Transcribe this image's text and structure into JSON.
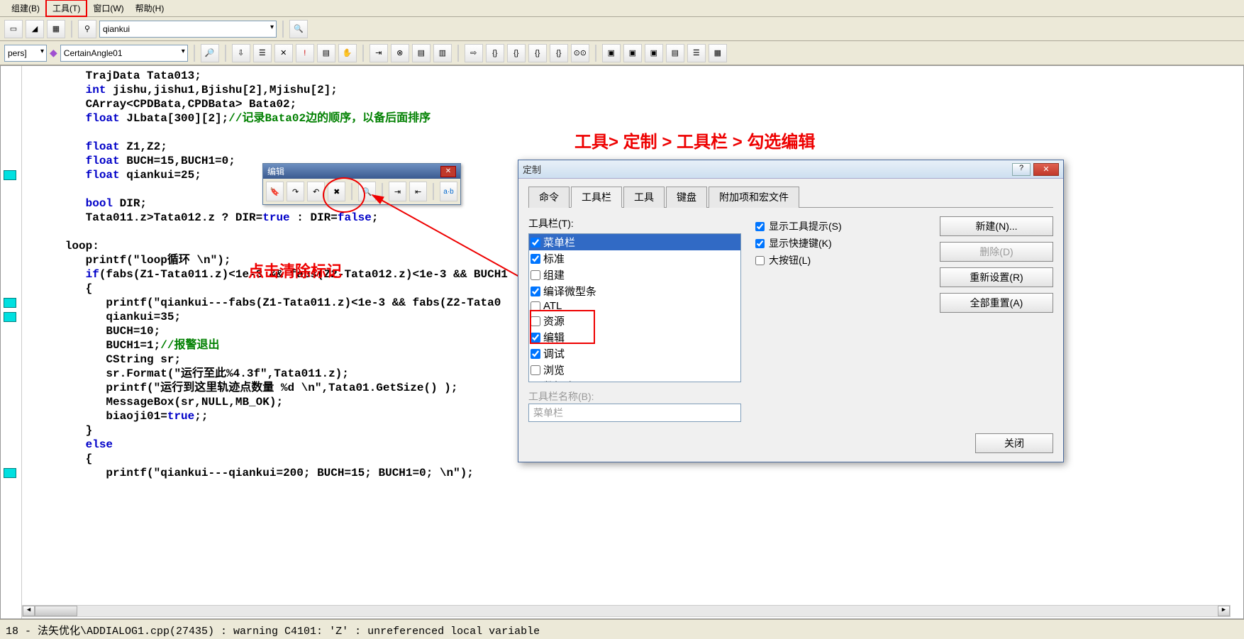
{
  "menu": {
    "build": "组建(B)",
    "tools": "工具(T)",
    "window": "窗口(W)",
    "help": "帮助(H)"
  },
  "toolbar2": {
    "search_value": "qiankui"
  },
  "toolbar3": {
    "left_label": "pers]",
    "combo_value": "CertainAngle01"
  },
  "float_tb": {
    "title": "编辑"
  },
  "anno": {
    "path_hint": "工具> 定制 > 工具栏 > 勾选编辑",
    "click_hint": "点击清除标记"
  },
  "code": [
    {
      "indent": 6,
      "segs": [
        {
          "t": "TrajData Tata013;",
          "c": ""
        }
      ]
    },
    {
      "indent": 6,
      "segs": [
        {
          "t": "int",
          "c": "kw"
        },
        {
          "t": " jishu,jishu1,Bjishu[2],Mjishu[2];",
          "c": ""
        }
      ]
    },
    {
      "indent": 6,
      "segs": [
        {
          "t": "CArray<CPDBata,CPDBata> Bata02;",
          "c": ""
        }
      ]
    },
    {
      "indent": 6,
      "segs": [
        {
          "t": "float",
          "c": "kw"
        },
        {
          "t": " JLbata[300][2];",
          "c": ""
        },
        {
          "t": "//记录Bata02边的顺序，以备后面排序",
          "c": "cm"
        }
      ]
    },
    {
      "indent": 6,
      "segs": [
        {
          "t": "",
          "c": ""
        }
      ]
    },
    {
      "indent": 6,
      "segs": [
        {
          "t": "float",
          "c": "kw"
        },
        {
          "t": " Z1,Z2;",
          "c": ""
        }
      ]
    },
    {
      "indent": 6,
      "segs": [
        {
          "t": "float",
          "c": "kw"
        },
        {
          "t": " BUCH=15,BUCH1=0;",
          "c": ""
        }
      ]
    },
    {
      "indent": 6,
      "bm": true,
      "segs": [
        {
          "t": "float",
          "c": "kw"
        },
        {
          "t": " qiankui=25;",
          "c": ""
        }
      ]
    },
    {
      "indent": 6,
      "segs": [
        {
          "t": "",
          "c": ""
        }
      ]
    },
    {
      "indent": 6,
      "segs": [
        {
          "t": "bool",
          "c": "kw"
        },
        {
          "t": " DIR;",
          "c": ""
        }
      ]
    },
    {
      "indent": 6,
      "segs": [
        {
          "t": "Tata011.z>Tata012.z ? DIR=",
          "c": ""
        },
        {
          "t": "true",
          "c": "tf"
        },
        {
          "t": " : DIR=",
          "c": ""
        },
        {
          "t": "false",
          "c": "tf"
        },
        {
          "t": ";",
          "c": ""
        }
      ]
    },
    {
      "indent": 6,
      "segs": [
        {
          "t": "",
          "c": ""
        }
      ]
    },
    {
      "indent": 3,
      "segs": [
        {
          "t": "loop:",
          "c": ""
        }
      ]
    },
    {
      "indent": 6,
      "segs": [
        {
          "t": "printf(\"loop循环 \\n\");",
          "c": ""
        }
      ]
    },
    {
      "indent": 6,
      "segs": [
        {
          "t": "if",
          "c": "kw"
        },
        {
          "t": "(fabs(Z1-Tata011.z)<1e-3 && fabs(Z2-Tata012.z)<1e-3 && BUCH1",
          "c": ""
        }
      ]
    },
    {
      "indent": 6,
      "segs": [
        {
          "t": "{",
          "c": ""
        }
      ]
    },
    {
      "indent": 9,
      "bm": true,
      "segs": [
        {
          "t": "printf(\"qiankui---fabs(Z1-Tata011.z)<1e-3 && fabs(Z2-Tata0",
          "c": ""
        }
      ]
    },
    {
      "indent": 9,
      "bm": true,
      "segs": [
        {
          "t": "qiankui=35;",
          "c": ""
        }
      ]
    },
    {
      "indent": 9,
      "segs": [
        {
          "t": "BUCH=10;",
          "c": ""
        }
      ]
    },
    {
      "indent": 9,
      "segs": [
        {
          "t": "BUCH1=1;",
          "c": ""
        },
        {
          "t": "//报警退出",
          "c": "cm"
        }
      ]
    },
    {
      "indent": 9,
      "segs": [
        {
          "t": "CString sr;",
          "c": ""
        }
      ]
    },
    {
      "indent": 9,
      "segs": [
        {
          "t": "sr.Format(\"运行至此%4.3f\",Tata011.z);",
          "c": ""
        }
      ]
    },
    {
      "indent": 9,
      "segs": [
        {
          "t": "printf(\"运行到这里轨迹点数量 %d \\n\",Tata01.GetSize() );",
          "c": ""
        }
      ]
    },
    {
      "indent": 9,
      "segs": [
        {
          "t": "MessageBox(sr,NULL,MB_OK);",
          "c": ""
        }
      ]
    },
    {
      "indent": 9,
      "segs": [
        {
          "t": "biaoji01=",
          "c": ""
        },
        {
          "t": "true",
          "c": "tf"
        },
        {
          "t": ";;",
          "c": ""
        }
      ]
    },
    {
      "indent": 6,
      "segs": [
        {
          "t": "}",
          "c": ""
        }
      ]
    },
    {
      "indent": 6,
      "segs": [
        {
          "t": "else",
          "c": "kw"
        }
      ]
    },
    {
      "indent": 6,
      "segs": [
        {
          "t": "{",
          "c": ""
        }
      ]
    },
    {
      "indent": 9,
      "bm": true,
      "segs": [
        {
          "t": "printf(\"qiankui---qiankui=200; BUCH=15; BUCH1=0; \\n\");",
          "c": ""
        }
      ]
    }
  ],
  "dialog": {
    "title": "定制",
    "tabs": [
      "命令",
      "工具栏",
      "工具",
      "键盘",
      "附加项和宏文件"
    ],
    "active_tab": 1,
    "list_label": "工具栏(T):",
    "items": [
      {
        "label": "菜单栏",
        "checked": true,
        "selected": true
      },
      {
        "label": "标准",
        "checked": true
      },
      {
        "label": "组建",
        "checked": false
      },
      {
        "label": "编译微型条",
        "checked": true
      },
      {
        "label": "ATL",
        "checked": false
      },
      {
        "label": "资源",
        "checked": false
      },
      {
        "label": "编辑",
        "checked": true
      },
      {
        "label": "调试",
        "checked": true
      },
      {
        "label": "浏览",
        "checked": false
      },
      {
        "label": "数据库",
        "checked": false
      }
    ],
    "chk_tooltip": "显示工具提示(S)",
    "chk_shortcut": "显示快捷键(K)",
    "chk_large": "大按钮(L)",
    "btn_new": "新建(N)...",
    "btn_del": "删除(D)",
    "btn_reset": "重新设置(R)",
    "btn_resetall": "全部重置(A)",
    "name_label": "工具栏名称(B):",
    "name_value": "菜单栏",
    "btn_close": "关闭"
  },
  "status": {
    "text": "18 - 法矢优化\\ADDIALOG1.cpp(27435) : warning C4101: 'Z' : unreferenced local variable"
  }
}
